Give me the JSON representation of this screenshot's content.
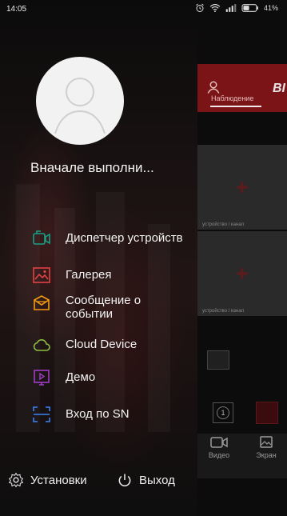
{
  "status_bar": {
    "time": "14:05",
    "battery": "41%"
  },
  "background_app": {
    "brand": "BI",
    "tab": "Наблюдение",
    "camera_label_1": "устройство / канал",
    "camera_label_2": "устройство / канал",
    "tile_number": "1",
    "bottom_tabs": [
      "Видео",
      "Экран"
    ]
  },
  "drawer": {
    "user_name": "Вначале выполни...",
    "menu": [
      {
        "label": "Диспетчер устройств",
        "icon": "devices-icon",
        "color": "#16a085"
      },
      {
        "label": "Галерея",
        "icon": "gallery-icon",
        "color": "#e04343"
      },
      {
        "label": "Сообщение о\nсобытии",
        "icon": "event-message-icon",
        "color": "#f39c12"
      },
      {
        "label": "Cloud Device",
        "icon": "cloud-icon",
        "color": "#8bbf3f"
      },
      {
        "label": "Демо",
        "icon": "demo-icon",
        "color": "#a03cc8"
      },
      {
        "label": "Вход по SN",
        "icon": "scan-sn-icon",
        "color": "#3b82f6"
      }
    ],
    "footer": {
      "settings": "Установки",
      "logout": "Выход"
    }
  }
}
